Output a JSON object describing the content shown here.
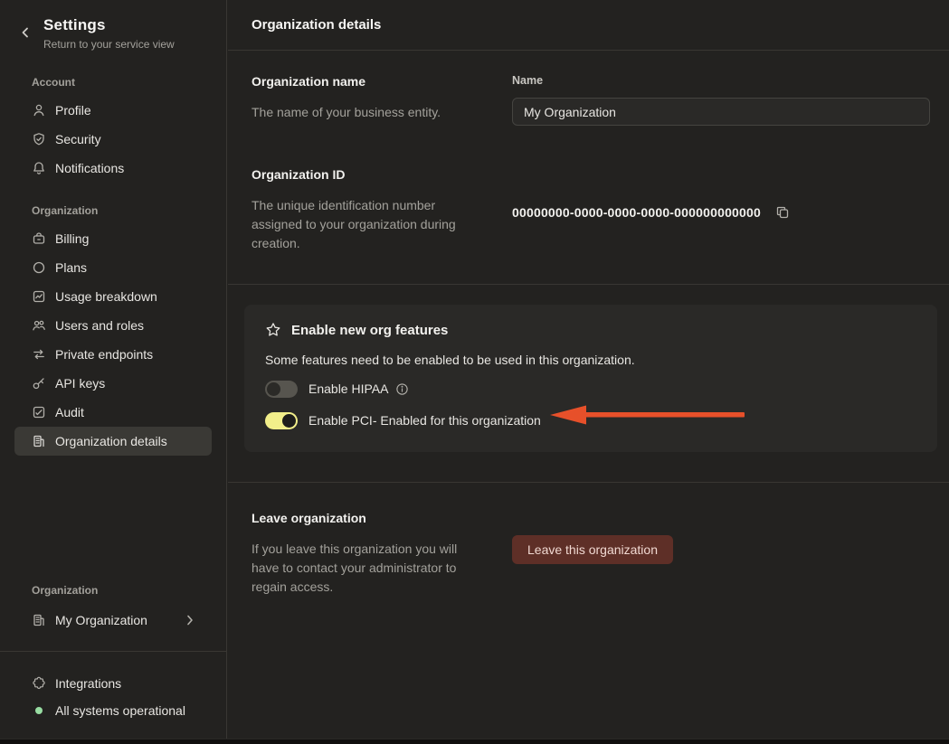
{
  "sidebar": {
    "title": "Settings",
    "subtitle": "Return to your service view",
    "account_section": {
      "label": "Account",
      "items": [
        {
          "icon": "person-icon",
          "label": "Profile"
        },
        {
          "icon": "shield-icon",
          "label": "Security"
        },
        {
          "icon": "bell-icon",
          "label": "Notifications"
        }
      ]
    },
    "organization_section": {
      "label": "Organization",
      "items": [
        {
          "icon": "billing-icon",
          "label": "Billing"
        },
        {
          "icon": "circle-icon",
          "label": "Plans"
        },
        {
          "icon": "chart-icon",
          "label": "Usage breakdown"
        },
        {
          "icon": "people-icon",
          "label": "Users and roles"
        },
        {
          "icon": "swap-arrows-icon",
          "label": "Private endpoints"
        },
        {
          "icon": "key-icon",
          "label": "API keys"
        },
        {
          "icon": "audit-icon",
          "label": "Audit"
        },
        {
          "icon": "building-icon",
          "label": "Organization details",
          "selected": true
        }
      ]
    },
    "org_switcher": {
      "label": "Organization",
      "name": "My Organization"
    },
    "footer": {
      "integrations_label": "Integrations",
      "status_label": "All systems operational"
    }
  },
  "main": {
    "header_title": "Organization details",
    "org_name": {
      "title": "Organization name",
      "description": "The name of your business entity.",
      "field_label": "Name",
      "field_value": "My Organization"
    },
    "org_id": {
      "title": "Organization ID",
      "description": "The unique identification number assigned to your organization during creation.",
      "value": "00000000-0000-0000-0000-000000000000"
    },
    "features": {
      "title": "Enable new org features",
      "description": "Some features need to be enabled to be used in this organization.",
      "toggles": [
        {
          "label": "Enable HIPAA",
          "on": false,
          "has_info": true
        },
        {
          "label": "Enable PCI- Enabled for this organization",
          "on": true,
          "has_info": false
        }
      ]
    },
    "leave": {
      "title": "Leave organization",
      "description": "If you leave this organization you will have to contact your administrator to regain access.",
      "button_label": "Leave this organization"
    }
  },
  "colors": {
    "background": "#232220",
    "card_background": "#2a2927",
    "toggle_on_yellow": "#f2ee8a",
    "annotation_arrow_red": "#e7502a",
    "status_green": "#98dda2",
    "danger_button": "#5e2f27"
  }
}
